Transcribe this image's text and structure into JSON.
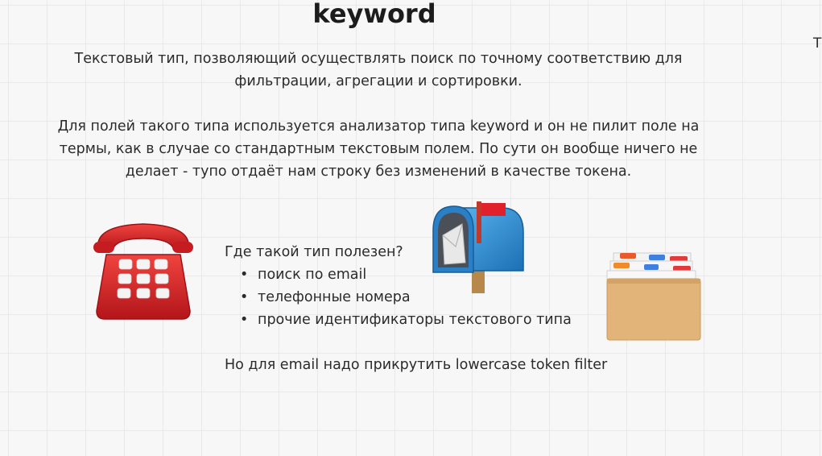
{
  "slide": {
    "title": "keyword",
    "paragraph_1_line_1": "Текстовый тип, позволяющий осуществлять поиск по точному соответствию для",
    "paragraph_1_line_2": "фильтрации, агрегации и сортировки.",
    "paragraph_2_line_1": "Для полей такого типа используется анализатор типа keyword и он не пилит поле на",
    "paragraph_2_line_2": "термы, как в случае со стандартным текстовым полем. По сути он вообще ничего не",
    "paragraph_2_line_3": "делает - тупо отдаёт нам строку без изменений в качестве токена.",
    "edge_fragment": "Т",
    "useful_question": "Где такой тип полезен?",
    "use_cases": [
      "поиск по email",
      "телефонные номера",
      "прочие идентификаторы текстового типа"
    ],
    "bullet_glyph": "•",
    "footer_note": "Но для email надо прикрутить lowercase token filter"
  },
  "icons": {
    "phone": "telephone-icon",
    "mailbox": "mailbox-icon",
    "cards": "card-file-box-icon"
  },
  "colors": {
    "phone_red": "#d8262a",
    "mailbox_blue": "#2d8fd6",
    "flag_red": "#e0202a",
    "box_tan": "#e2b47a"
  }
}
